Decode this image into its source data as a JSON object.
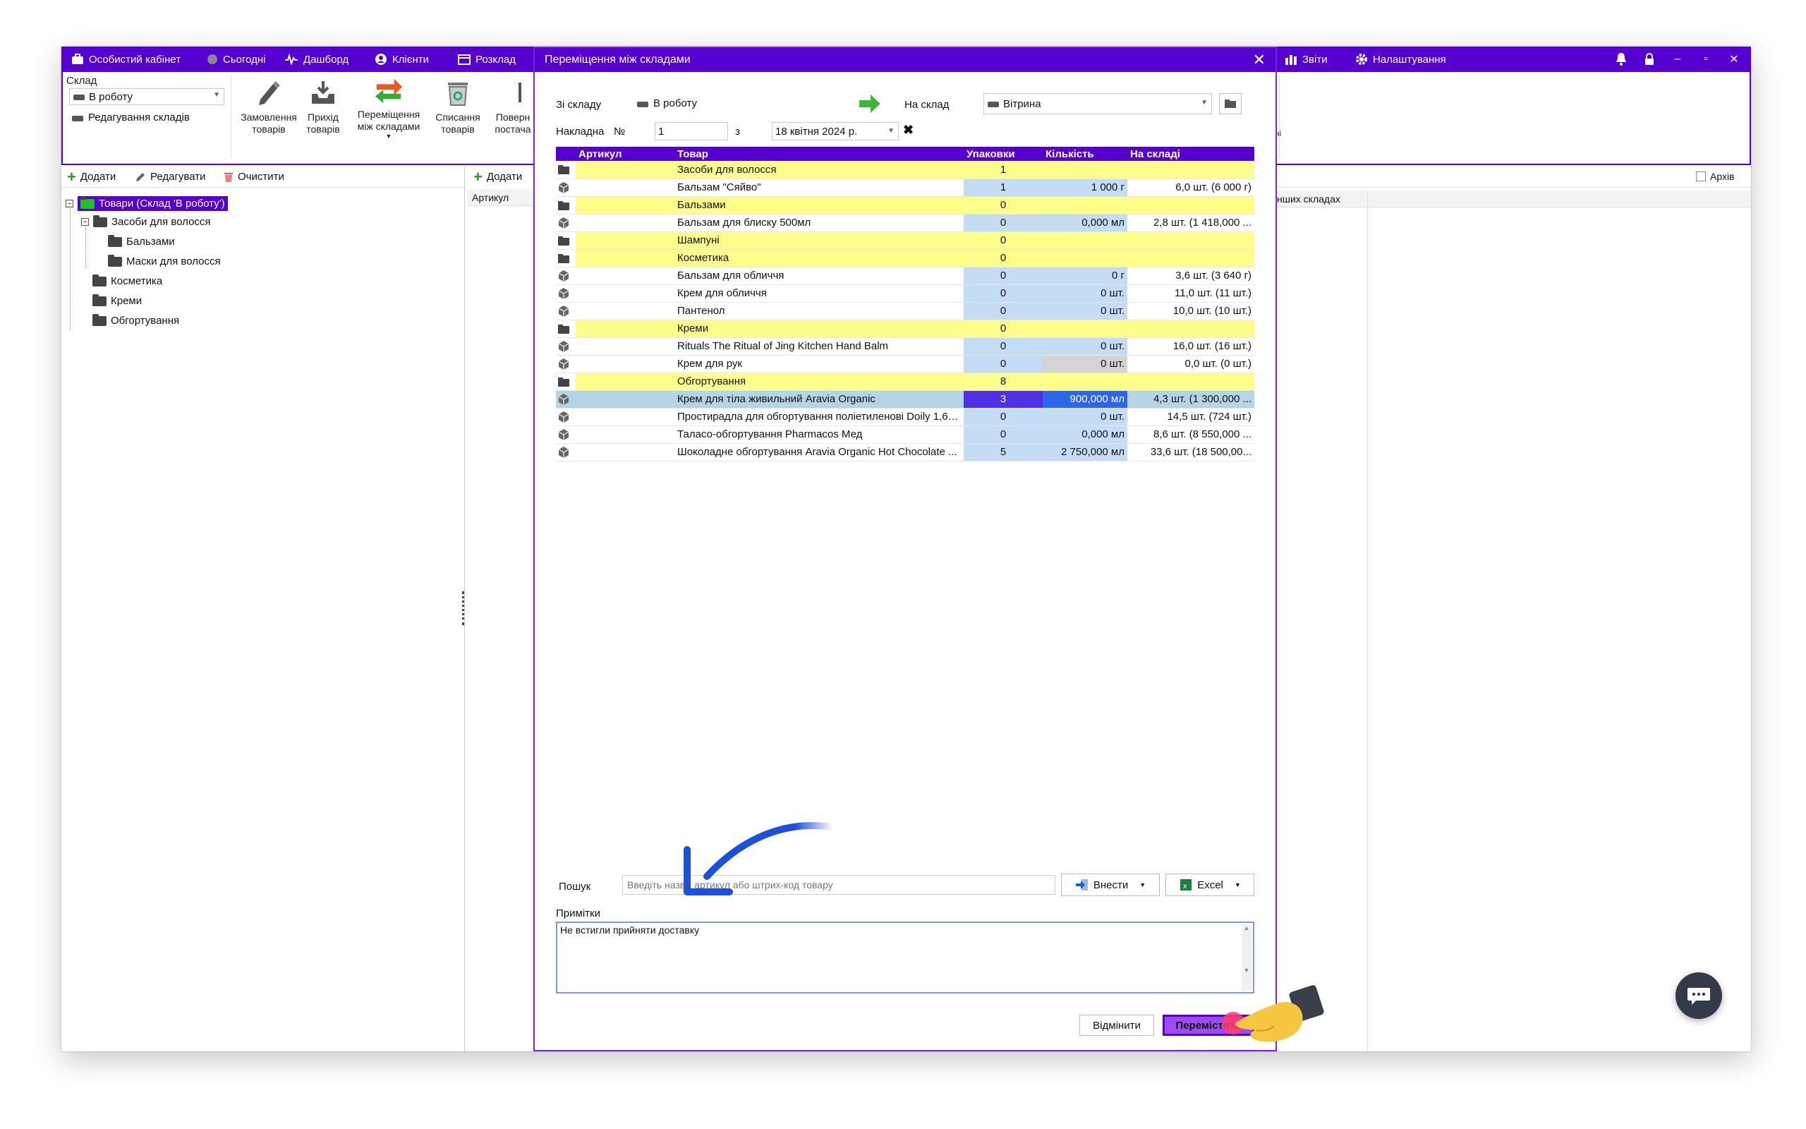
{
  "topnav": {
    "account": "Особистий кабінет",
    "today": "Сьогодні",
    "dashboard": "Дашборд",
    "clients": "Клієнти",
    "schedule": "Розклад",
    "reports": "Звіти",
    "settings": "Налаштування"
  },
  "ribbon": {
    "warehouse_label": "Склад",
    "warehouse_value": "В роботу",
    "edit_warehouses": "Редагування складів",
    "order": "Замовлення товарів",
    "receipt": "Прихід товарів",
    "transfer": "Переміщення між складами",
    "writeoff": "Списання товарів",
    "return": "Поверн постача",
    "right_partial": "ні"
  },
  "left_pane": {
    "add": "Додати",
    "edit": "Редагувати",
    "clear": "Очистити",
    "tree_root": "Товари (Склад 'В роботу')",
    "tree": [
      {
        "label": "Засоби для волосся",
        "level": 1,
        "expander": "-"
      },
      {
        "label": "Бальзами",
        "level": 2
      },
      {
        "label": "Маски для волосся",
        "level": 2
      },
      {
        "label": "Косметика",
        "level": 1
      },
      {
        "label": "Креми",
        "level": 1
      },
      {
        "label": "Обгортування",
        "level": 1
      }
    ]
  },
  "mid_pane": {
    "add": "Додати",
    "col_article": "Артикул"
  },
  "right_pane": {
    "archive": "Архів",
    "col_other": "нших складах"
  },
  "dialog": {
    "title": "Переміщення між складами",
    "from_label": "Зі складу",
    "from_value": "В роботу",
    "to_label": "На склад",
    "to_value": "Вітрина",
    "invoice_label": "Накладна",
    "invoice_no_label": "№",
    "invoice_no": "1",
    "date_from": "з",
    "date_value": "18 квітня 2024 р.",
    "columns": {
      "article": "Артикул",
      "product": "Товар",
      "packs": "Упаковки",
      "qty": "Кількість",
      "stock": "На складі"
    },
    "rows": [
      {
        "type": "cat",
        "product": "Засоби для волосся",
        "packs": "1",
        "qty": "",
        "stock": ""
      },
      {
        "type": "item",
        "product": "Бальзам \"Сяйво\"",
        "packs": "1",
        "qty": "1 000 г",
        "stock": "6,0 шт. (6 000 г)"
      },
      {
        "type": "cat",
        "product": "Бальзами",
        "packs": "0",
        "qty": "",
        "stock": ""
      },
      {
        "type": "item",
        "product": "Бальзам для блиску 500мл",
        "packs": "0",
        "qty": "0,000 мл",
        "stock": "2,8 шт. (1 418,000 ..."
      },
      {
        "type": "cat",
        "product": "Шампуні",
        "packs": "0",
        "qty": "",
        "stock": ""
      },
      {
        "type": "cat",
        "product": "Косметика",
        "packs": "0",
        "qty": "",
        "stock": ""
      },
      {
        "type": "item",
        "product": "Бальзам для обличчя",
        "packs": "0",
        "qty": "0 г",
        "stock": "3,6 шт. (3 640 г)"
      },
      {
        "type": "item",
        "product": "Крем для обличчя",
        "packs": "0",
        "qty": "0 шт.",
        "stock": "11,0 шт. (11 шт.)"
      },
      {
        "type": "item",
        "product": "Пантенол",
        "packs": "0",
        "qty": "0 шт.",
        "stock": "10,0 шт. (10 шт.)"
      },
      {
        "type": "cat",
        "product": "Креми",
        "packs": "0",
        "qty": "",
        "stock": ""
      },
      {
        "type": "item",
        "product": "Rituals The Ritual of Jing Kitchen Hand Balm",
        "packs": "0",
        "qty": "0 шт.",
        "stock": "16,0 шт. (16 шт.)"
      },
      {
        "type": "item",
        "product": "Крем для рук",
        "packs": "0",
        "qty": "0 шт.",
        "stock": "0,0 шт. (0 шт.)",
        "grey": true
      },
      {
        "type": "cat",
        "product": "Обгортування",
        "packs": "8",
        "qty": "",
        "stock": ""
      },
      {
        "type": "item",
        "product": "Крем для тіла живильний Aravia Organic",
        "packs": "3",
        "qty": "900,000 мл",
        "stock": "4,3 шт. (1 300,000 ...",
        "selected": true
      },
      {
        "type": "item",
        "product": "Простирадла для обгортування поліетиленові Doily 1,6х...",
        "packs": "0",
        "qty": "0 шт.",
        "stock": "14,5 шт. (724 шт.)"
      },
      {
        "type": "item",
        "product": "Таласо-обгортування Pharmacos Мед",
        "packs": "0",
        "qty": "0,000 мл",
        "stock": "8,6 шт. (8 550,000 ..."
      },
      {
        "type": "item",
        "product": "Шоколадне обгортування Aravia Organic Hot Chocolate ...",
        "packs": "5",
        "qty": "2 750,000 мл",
        "stock": "33,6 шт. (18 500,00..."
      }
    ],
    "search_label": "Пошук",
    "search_placeholder": "Введіть назву, артикул або штрих-код товару",
    "import_button": "Внести",
    "excel_button": "Excel",
    "notes_label": "Примітки",
    "notes_value": "Не встигли прийняти доставку",
    "cancel_button": "Відмінити",
    "move_button": "Перемістити"
  },
  "colors": {
    "brand": "#5500d0",
    "category_row": "#fdfd8a",
    "qty_cell": "#c5dcf5",
    "arrow": "#1a4fe0"
  }
}
